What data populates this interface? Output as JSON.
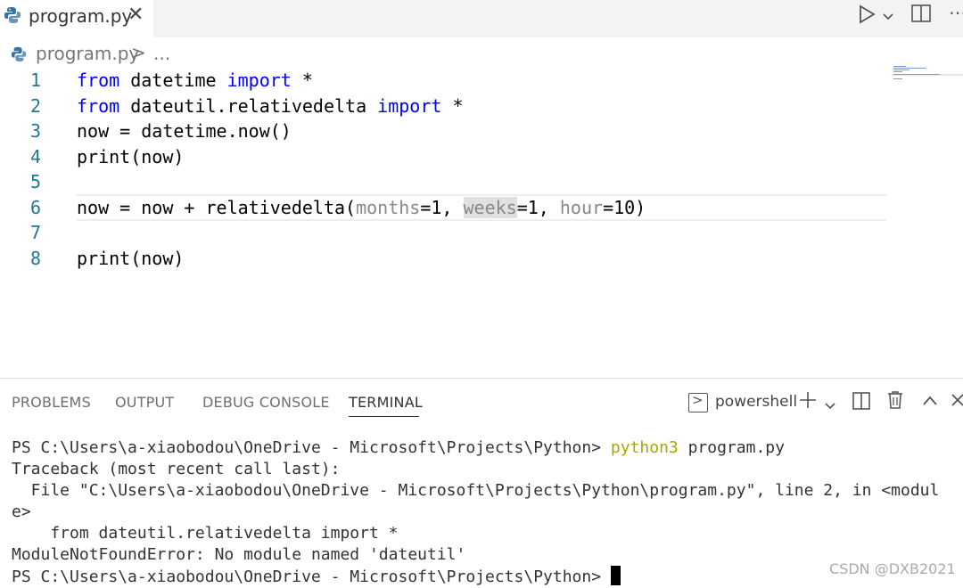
{
  "tab": {
    "filename": "program.py",
    "close_icon": "close-icon"
  },
  "breadcrumb": {
    "file": "program.py",
    "separator": ">",
    "more": "..."
  },
  "editor": {
    "line_numbers": [
      "1",
      "2",
      "3",
      "4",
      "5",
      "6",
      "7",
      "8"
    ],
    "lines": [
      {
        "kw1": "from",
        "rest1": " datetime ",
        "kw2": "import",
        "rest2": " *"
      },
      {
        "kw1": "from",
        "rest1": " dateutil.relativedelta ",
        "kw2": "import",
        "rest2": " *"
      },
      {
        "text": "now = datetime.now()"
      },
      {
        "text": "print(now)"
      },
      {
        "text": ""
      },
      {
        "pre": "now = now + relativedelta(",
        "p1": "months",
        "v1": "=1, ",
        "p2": "weeks",
        "v2": "=1, ",
        "p3": "hour",
        "v3": "=10)"
      },
      {
        "text": ""
      },
      {
        "text": "print(now)"
      }
    ]
  },
  "panel": {
    "tabs": [
      "PROBLEMS",
      "OUTPUT",
      "DEBUG CONSOLE",
      "TERMINAL"
    ],
    "active_tab": "TERMINAL",
    "shell": "powershell"
  },
  "terminal": {
    "prompt": "PS C:\\Users\\a-xiaobodou\\OneDrive - Microsoft\\Projects\\Python> ",
    "command": "python3",
    "command_args": " program.py",
    "lines": [
      "Traceback (most recent call last):",
      "  File \"C:\\Users\\a-xiaobodou\\OneDrive - Microsoft\\Projects\\Python\\program.py\", line 2, in <modul",
      "e>",
      "    from dateutil.relativedelta import *",
      "ModuleNotFoundError: No module named 'dateutil'"
    ],
    "final_prompt": "PS C:\\Users\\a-xiaobodou\\OneDrive - Microsoft\\Projects\\Python> "
  },
  "watermark": "CSDN @DXB2021",
  "colors": {
    "keyword": "#0000ff",
    "line_number": "#237893",
    "command": "#aaa600",
    "hint": "#888888"
  }
}
